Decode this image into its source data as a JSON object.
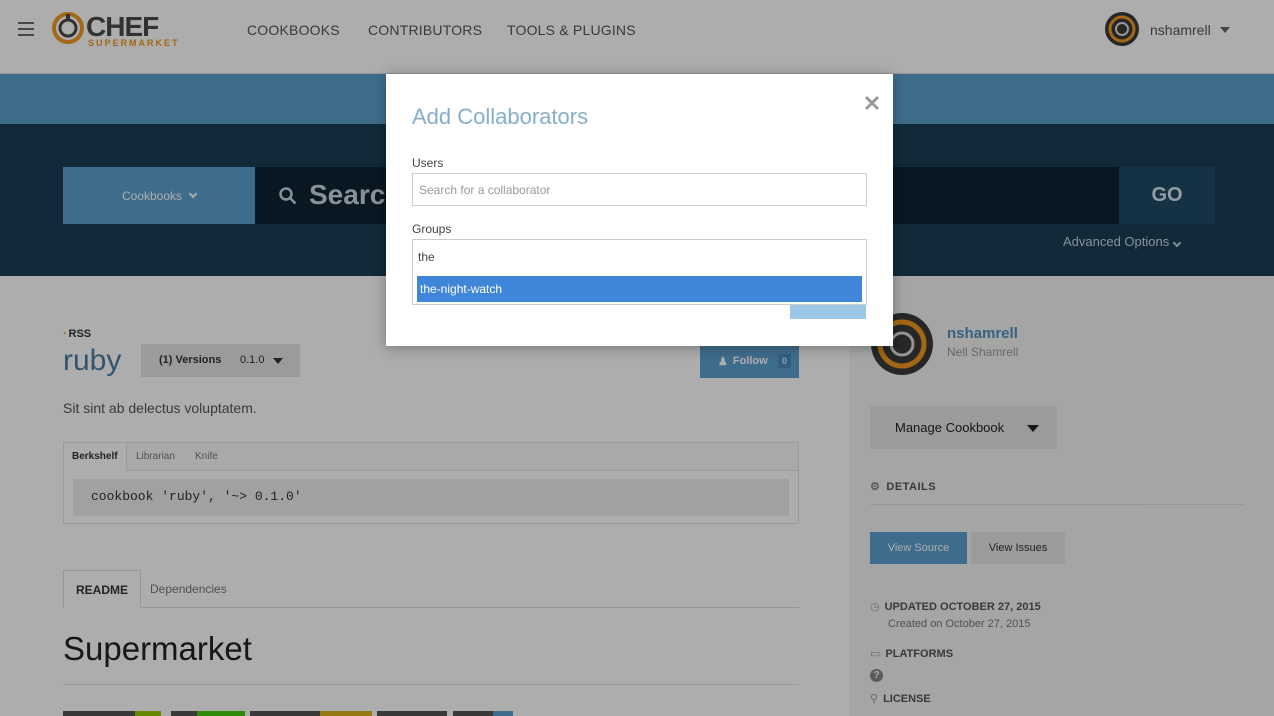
{
  "nav": {
    "logo_text": "CHEF",
    "logo_sub": "SUPERMARKET",
    "links": [
      "COOKBOOKS",
      "CONTRIBUTORS",
      "TOOLS & PLUGINS"
    ],
    "username": "nshamrell"
  },
  "search": {
    "category": "Cookbooks",
    "text": "Searc",
    "go_label": "GO",
    "advanced": "Advanced Options"
  },
  "cookbook": {
    "rss": "RSS",
    "title": "ruby",
    "versions_label": "(1) Versions",
    "version": "0.1.0",
    "follow_label": "Follow",
    "follow_count": "0",
    "description": "Sit sint ab delectus voluptatem.",
    "install_tabs": [
      "Berkshelf",
      "Librarian",
      "Knife"
    ],
    "code": "cookbook 'ruby', '~> 0.1.0'",
    "content_tabs": [
      "README",
      "Dependencies"
    ],
    "readme_heading": "Supermarket"
  },
  "sidebar": {
    "owner_username": "nshamrell",
    "owner_fullname": "Nell Shamrell",
    "manage_label": "Manage Cookbook",
    "details_label": "DETAILS",
    "view_source": "View Source",
    "view_issues": "View Issues",
    "updated": "UPDATED OCTOBER 27, 2015",
    "created": "Created on October 27, 2015",
    "platforms": "PLATFORMS",
    "license": "LICENSE"
  },
  "modal": {
    "title": "Add Collaborators",
    "users_label": "Users",
    "users_placeholder": "Search for a collaborator",
    "groups_label": "Groups",
    "groups_typed": "the",
    "suggestion": "the-night-watch"
  },
  "colors": {
    "accent_blue": "#5c9fcf",
    "dark_band": "#1a3d55",
    "highlight": "#3f86d9",
    "chef_orange": "#f09820"
  }
}
